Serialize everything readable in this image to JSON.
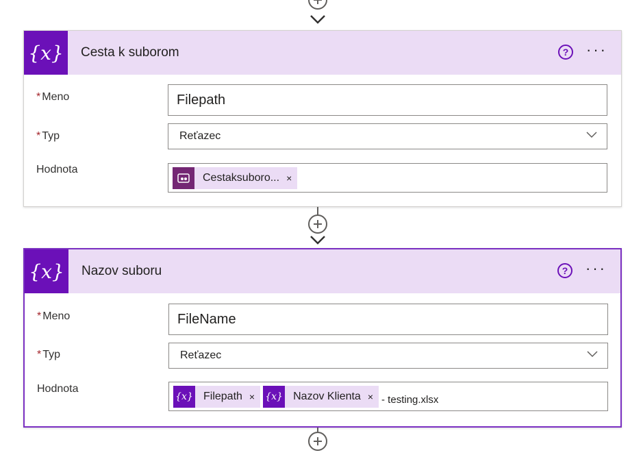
{
  "colors": {
    "accent": "#6b10b8",
    "header_bg": "#ebdcf5",
    "selected_border": "#7a2fc1",
    "required": "#a4262c"
  },
  "cards": [
    {
      "title": "Cesta k suborom",
      "selected": false,
      "fields": {
        "name_label": "Meno",
        "name_value": "Filepath",
        "type_label": "Typ",
        "type_value": "Reťazec",
        "value_label": "Hodnota",
        "tokens": [
          {
            "icon": "power-apps-icon",
            "label": "Cestaksuboro..."
          }
        ],
        "suffix": ""
      }
    },
    {
      "title": "Nazov suboru",
      "selected": true,
      "fields": {
        "name_label": "Meno",
        "name_value": "FileName",
        "type_label": "Typ",
        "type_value": "Reťazec",
        "value_label": "Hodnota",
        "tokens": [
          {
            "icon": "variable-icon",
            "label": "Filepath"
          },
          {
            "icon": "variable-icon",
            "label": "Nazov Klienta"
          }
        ],
        "suffix": "- testing.xlsx"
      }
    }
  ],
  "icons": {
    "variable_glyph": "{x}",
    "required_mark": "*",
    "close_glyph": "×",
    "help_glyph": "?",
    "more_glyph": "···"
  }
}
